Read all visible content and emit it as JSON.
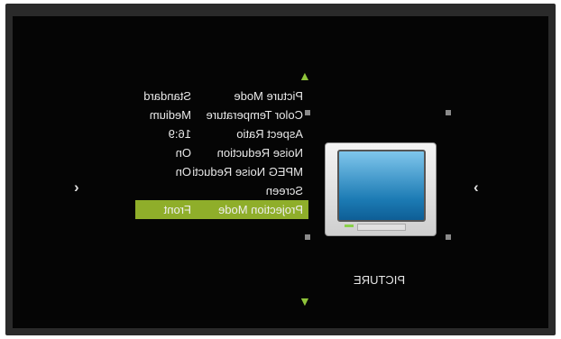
{
  "menu": {
    "items": [
      {
        "label": "Picture Mode",
        "value": "Standard"
      },
      {
        "label": "Color Temperature",
        "value": "Medium"
      },
      {
        "label": "Aspect Ratio",
        "value": "16:9"
      },
      {
        "label": "Noise Reduction",
        "value": "On"
      },
      {
        "label": "MPEG Noise Reducti",
        "value": "On"
      },
      {
        "label": "Screen",
        "value": ""
      },
      {
        "label": "Projection Mode",
        "value": "Front"
      }
    ],
    "selected_index": 6
  },
  "category": {
    "caption": "PICTURE",
    "icon": "tv-icon"
  },
  "nav": {
    "up": "▲",
    "down": "▼",
    "left": "‹",
    "right": "›"
  },
  "colors": {
    "accent": "#8fae2a",
    "background": "#050505"
  }
}
